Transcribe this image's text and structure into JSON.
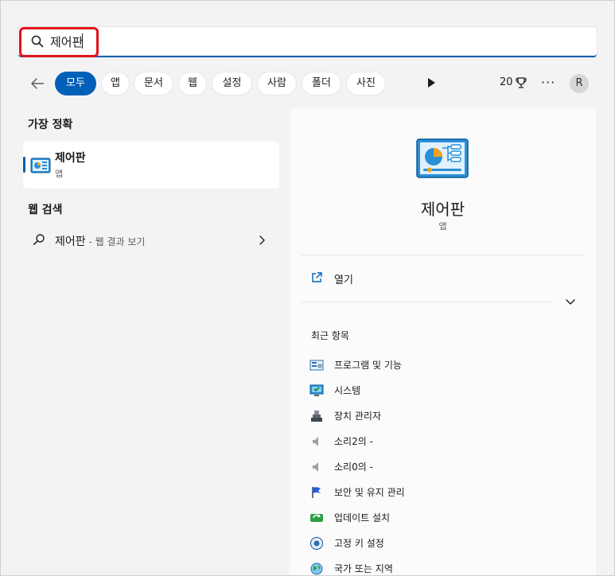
{
  "search": {
    "value": "제어판"
  },
  "filters": [
    "모두",
    "앱",
    "문서",
    "웹",
    "설정",
    "사람",
    "폴더",
    "사진"
  ],
  "toolbar": {
    "points": "20",
    "avatar_initial": "R",
    "more": "···"
  },
  "best_match": {
    "header": "가장 정확",
    "title": "제어판",
    "subtitle": "앱"
  },
  "web_search": {
    "header": "웹 검색",
    "query": "제어판",
    "suffix": " - 웹 결과 보기"
  },
  "preview": {
    "title": "제어판",
    "subtitle": "앱",
    "open_label": "열기",
    "recent_header": "최근 항목",
    "recent_items": [
      {
        "label": "프로그램 및 기능",
        "icon": "programs-icon"
      },
      {
        "label": "시스템",
        "icon": "system-icon"
      },
      {
        "label": "장치 관리자",
        "icon": "device-manager-icon"
      },
      {
        "label": "소리2의 -",
        "icon": "speaker-icon"
      },
      {
        "label": "소리0의 -",
        "icon": "speaker-icon"
      },
      {
        "label": "보안 및 유지 관리",
        "icon": "flag-icon"
      },
      {
        "label": "업데이트 설치",
        "icon": "update-icon"
      },
      {
        "label": "고정 키 설정",
        "icon": "sticky-keys-icon"
      },
      {
        "label": "국가 또는 지역",
        "icon": "globe-icon"
      }
    ]
  },
  "colors": {
    "accent": "#005fb8",
    "highlight": "#e3121b"
  }
}
